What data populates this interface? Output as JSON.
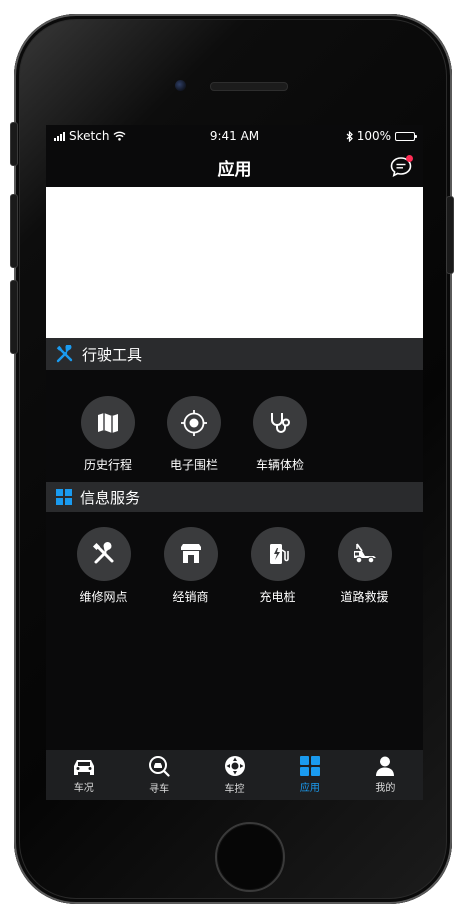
{
  "status_bar": {
    "carrier": "Sketch",
    "time": "9:41 AM",
    "battery": "100%"
  },
  "navbar": {
    "title": "应用"
  },
  "sections": {
    "driving_tools": {
      "title": "行驶工具",
      "items": [
        {
          "label": "历史行程",
          "icon": "map-icon"
        },
        {
          "label": "电子围栏",
          "icon": "target-icon"
        },
        {
          "label": "车辆体检",
          "icon": "stethoscope-icon"
        }
      ]
    },
    "info_services": {
      "title": "信息服务",
      "items": [
        {
          "label": "维修网点",
          "icon": "repair-tools-icon"
        },
        {
          "label": "经销商",
          "icon": "store-icon"
        },
        {
          "label": "充电桩",
          "icon": "charging-pile-icon"
        },
        {
          "label": "道路救援",
          "icon": "tow-truck-icon"
        }
      ]
    }
  },
  "tabbar": {
    "items": [
      {
        "label": "车况",
        "icon": "car-icon"
      },
      {
        "label": "寻车",
        "icon": "find-car-icon"
      },
      {
        "label": "车控",
        "icon": "car-control-icon"
      },
      {
        "label": "应用",
        "icon": "apps-grid-icon",
        "active": true
      },
      {
        "label": "我的",
        "icon": "user-icon"
      }
    ]
  },
  "colors": {
    "accent": "#1a9bf0",
    "badge": "#ff2d55",
    "screen_bg": "#0a0a0b",
    "section_bg": "#2a2b2d",
    "icon_circle": "#3a3b3d"
  }
}
